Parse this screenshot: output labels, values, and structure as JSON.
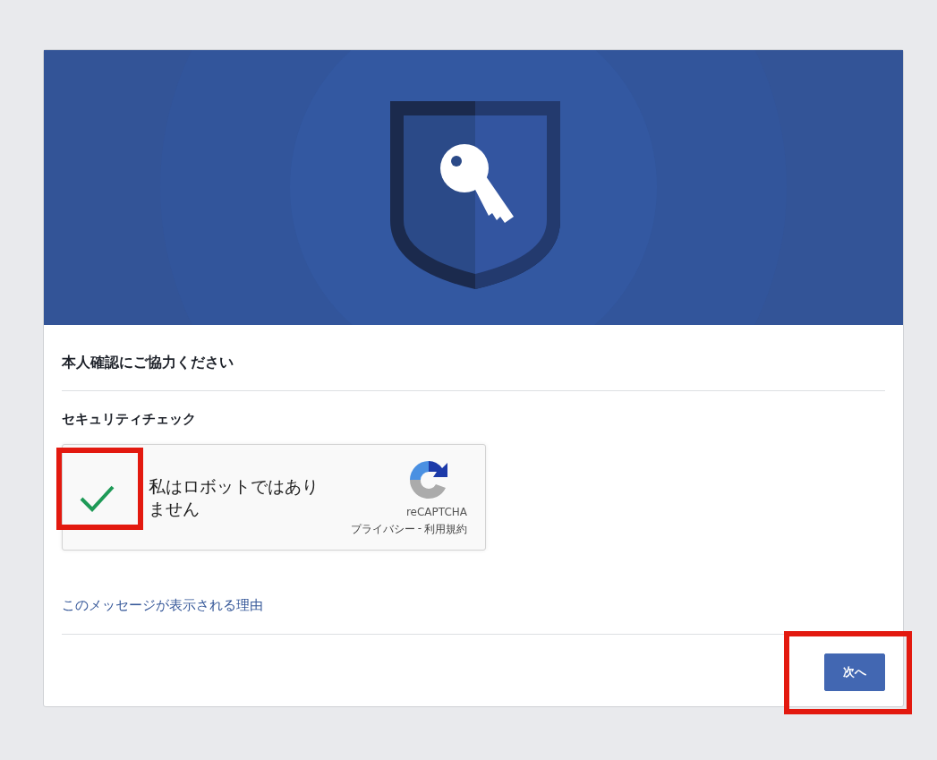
{
  "heading": "本人確認にご協力ください",
  "section_label": "セキュリティチェック",
  "captcha": {
    "label": "私はロボットではありません",
    "checked": true,
    "brand": "reCAPTCHA",
    "privacy_link": "プライバシー",
    "separator": "-",
    "terms_link": "利用規約"
  },
  "help_link": "このメッセージが表示される理由",
  "next_button": "次へ"
}
